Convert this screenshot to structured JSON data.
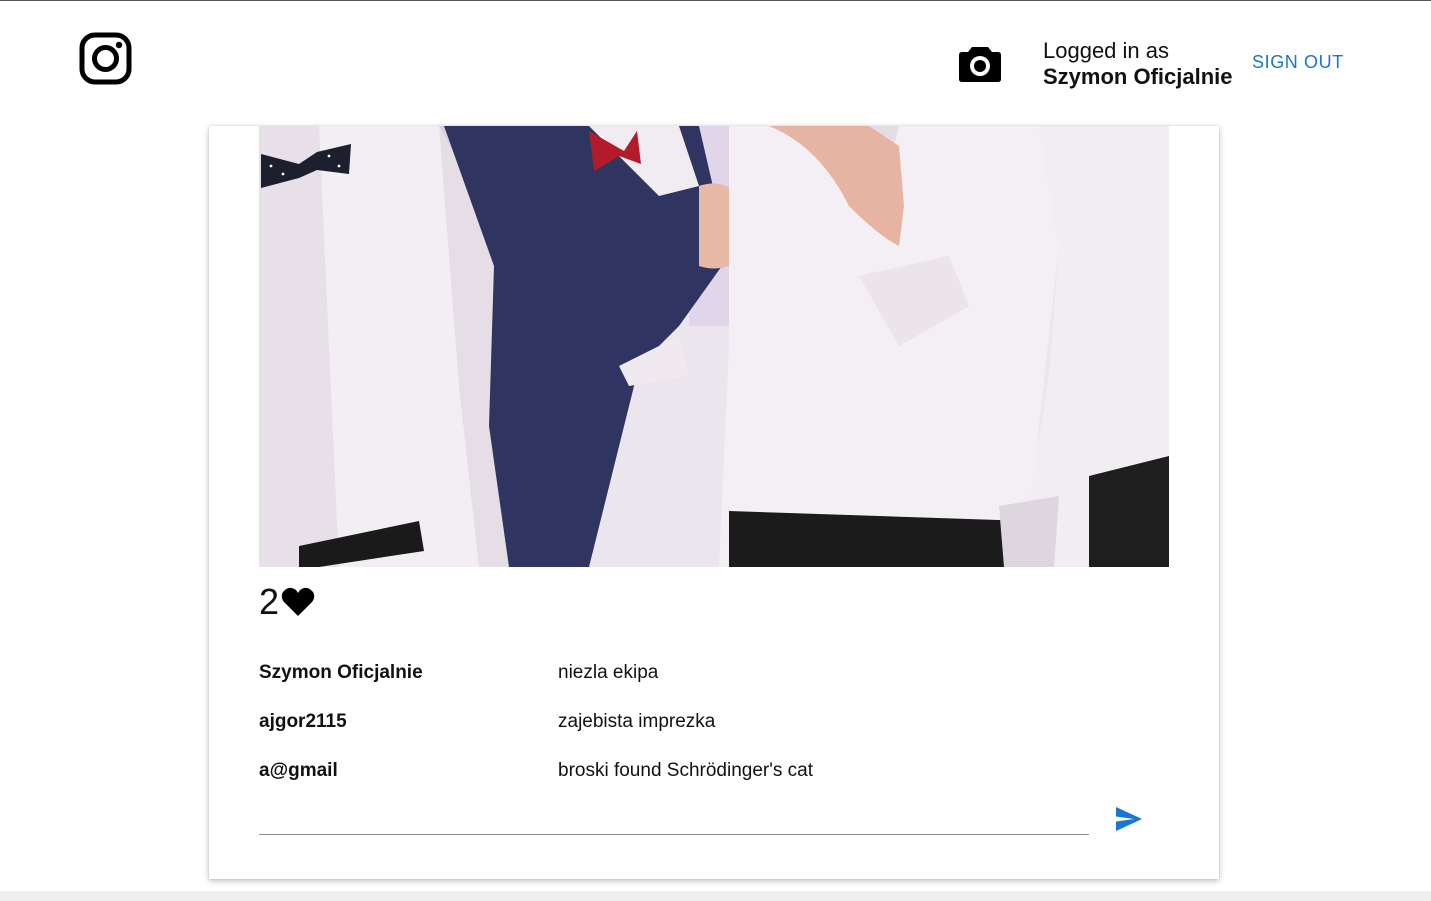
{
  "header": {
    "logo_icon": "instagram-icon",
    "upload_icon": "camera-icon",
    "logged_in_label": "Logged in as",
    "username": "Szymon Oficjalnie",
    "sign_out_label": "SIGN OUT",
    "accent_color": "#1976d2"
  },
  "post": {
    "image_alt": "Group of men in white shirts with bow ties",
    "likes_count": "2",
    "like_icon": "heart-icon",
    "comments": [
      {
        "user": "Szymon Oficjalnie",
        "text": "niezla ekipa"
      },
      {
        "user": "ajgor2115",
        "text": "zajebista imprezka"
      },
      {
        "user": "a@gmail",
        "text": "broski found Schrödinger's cat"
      }
    ],
    "comment_input": {
      "value": "",
      "placeholder": ""
    },
    "send_icon": "send-icon"
  }
}
